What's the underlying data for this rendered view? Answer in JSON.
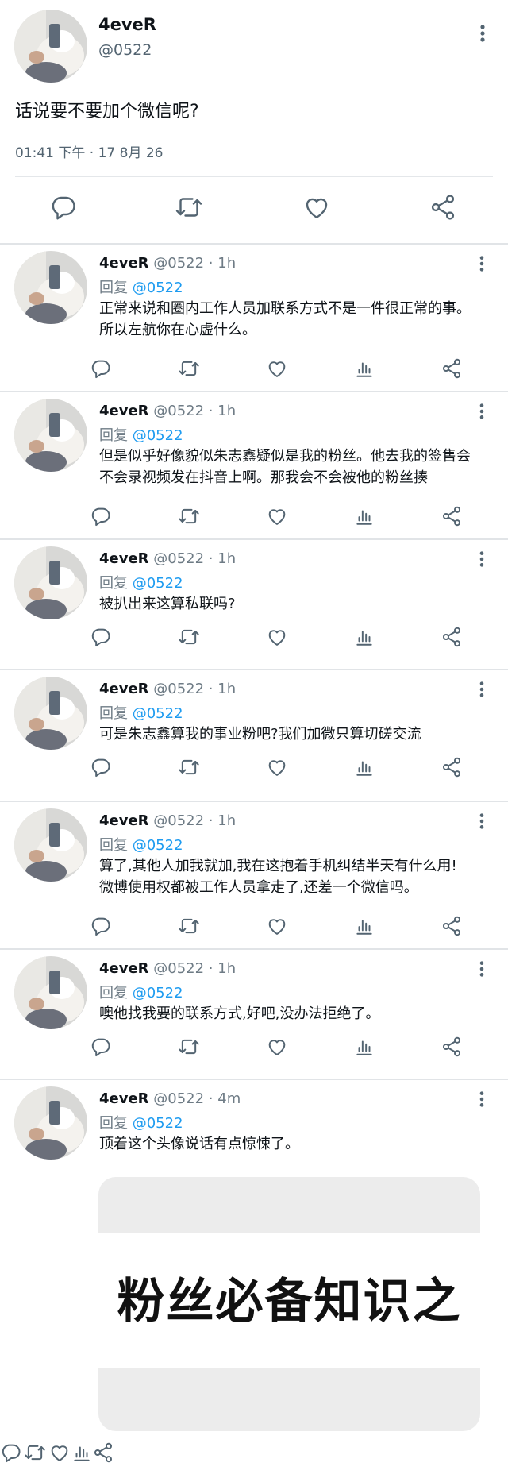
{
  "main": {
    "name": "4eveR",
    "handle": "@0522",
    "text": "话说要不要加个微信呢?",
    "time": "01:41 下午 · 17 8月 26",
    "icons": {
      "more": "more-vertical-icon",
      "reply": "reply-icon",
      "retweet": "retweet-icon",
      "like": "heart-icon",
      "share": "share-icon"
    }
  },
  "reply_prefix": "回复",
  "replies": [
    {
      "name": "4eveR",
      "meta": "@0522 · 1h",
      "to": "@0522",
      "lines": [
        "正常来说和圈内工作人员加联系方式不是一件很正常的事。",
        "所以左航你在心虚什么。"
      ]
    },
    {
      "name": "4eveR",
      "meta": "@0522 · 1h",
      "to": "@0522",
      "lines": [
        "但是似乎好像貌似朱志鑫疑似是我的粉丝。他去我的签售会",
        "不会录视频发在抖音上啊。那我会不会被他的粉丝揍"
      ]
    },
    {
      "name": "4eveR",
      "meta": "@0522 · 1h",
      "to": "@0522",
      "lines": [
        "被扒出来这算私联吗?"
      ]
    },
    {
      "name": "4eveR",
      "meta": "@0522 · 1h",
      "to": "@0522",
      "lines": [
        "可是朱志鑫算我的事业粉吧?我们加微只算切磋交流"
      ]
    },
    {
      "name": "4eveR",
      "meta": "@0522 · 1h",
      "to": "@0522",
      "lines": [
        "算了,其他人加我就加,我在这抱着手机纠结半天有什么用!",
        "微博使用权都被工作人员拿走了,还差一个微信吗。"
      ]
    },
    {
      "name": "4eveR",
      "meta": "@0522 · 1h",
      "to": "@0522",
      "lines": [
        "噢他找我要的联系方式,好吧,没办法拒绝了。"
      ]
    },
    {
      "name": "4eveR",
      "meta": "@0522 · 4m",
      "to": "@0522",
      "lines": [
        "顶着这个头像说话有点惊悚了。"
      ],
      "card_text": "粉丝必备知识之"
    }
  ],
  "colors": {
    "accent": "#1d9bf0",
    "secondary_text": "#6e7b85",
    "divider": "#e1e4e7"
  }
}
